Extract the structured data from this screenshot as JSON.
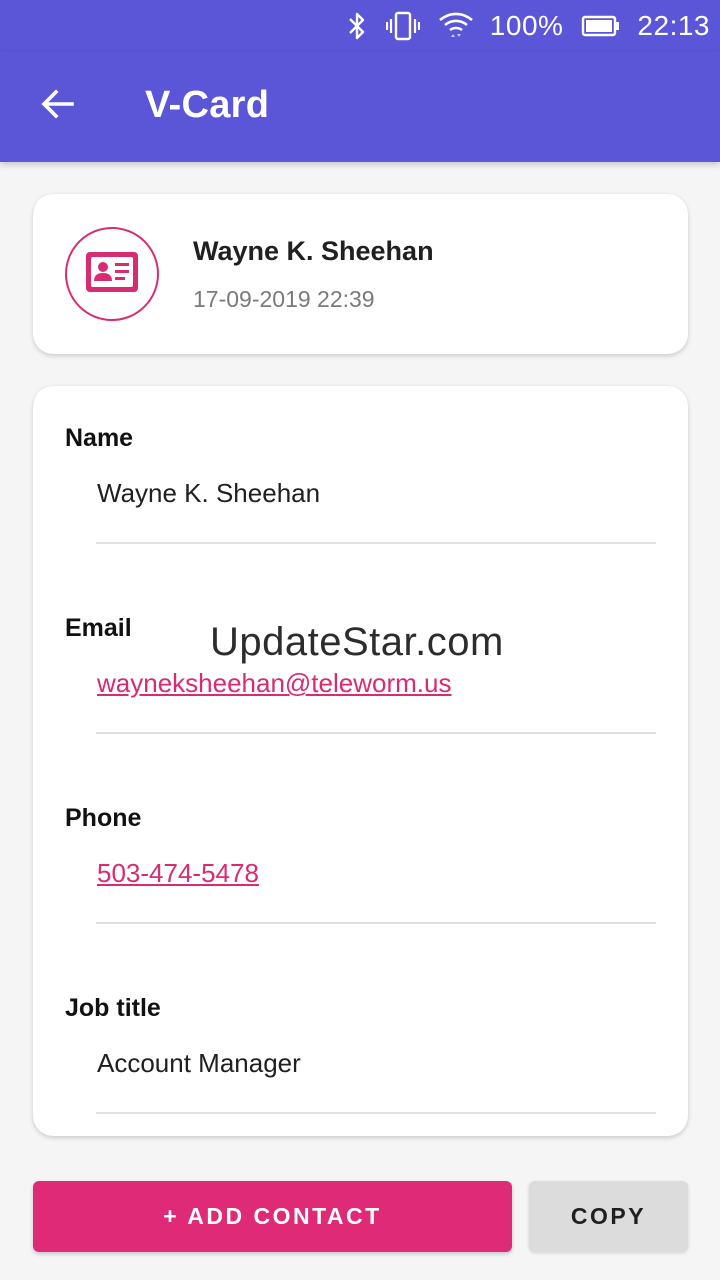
{
  "status_bar": {
    "battery_percent": "100%",
    "time": "22:13",
    "icons": [
      "bluetooth-icon",
      "vibrate-icon",
      "wifi-icon",
      "battery-icon"
    ]
  },
  "app_bar": {
    "title": "V-Card",
    "back_icon": "arrow-back-icon"
  },
  "header_card": {
    "name": "Wayne K. Sheehan",
    "date": "17-09-2019 22:39",
    "icon": "contact-card-icon"
  },
  "fields": [
    {
      "label": "Name",
      "value": "Wayne K. Sheehan",
      "link": false
    },
    {
      "label": "Email",
      "value": "wayneksheehan@teleworm.us",
      "link": true
    },
    {
      "label": "Phone",
      "value": "503-474-5478",
      "link": true
    },
    {
      "label": "Job title",
      "value": "Account Manager",
      "link": false
    }
  ],
  "watermark": "UpdateStar.com",
  "buttons": {
    "add_contact": "+ ADD CONTACT",
    "copy": "COPY"
  },
  "colors": {
    "primary": "#5b55d8",
    "accent": "#df2a78",
    "link": "#d92b72",
    "secondary_button": "#dcdcdc"
  }
}
